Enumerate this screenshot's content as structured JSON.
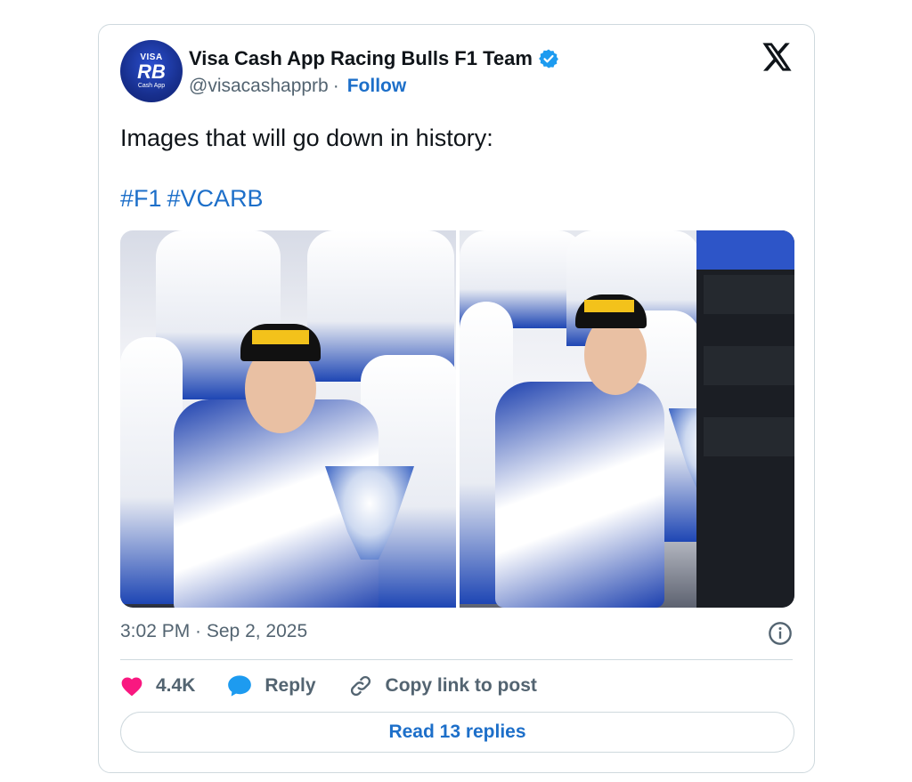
{
  "author": {
    "display_name": "Visa Cash App Racing Bulls F1 Team",
    "handle": "@visacashapprb",
    "separator": "·",
    "follow_label": "Follow",
    "avatar": {
      "top_text": "VISA",
      "mid_text": "RB",
      "bottom_text": "Cash App",
      "bg_color": "#18308f"
    },
    "verified_badge_color": "#1d9bf0"
  },
  "tweet": {
    "text": "Images that will go down in history:",
    "hashtags": [
      "#F1",
      "#VCARB"
    ],
    "timestamp": "3:02 PM · Sep 2, 2025"
  },
  "media": {
    "photos": [
      {
        "name": "driver-celebrating-with-trophy-left",
        "main_color": "#1b3fae"
      },
      {
        "name": "driver-celebrating-with-crew-right",
        "main_color": "#1b3fae"
      }
    ]
  },
  "actions": {
    "likes_count": "4.4K",
    "reply_label": "Reply",
    "copy_link_label": "Copy link to post",
    "read_replies_label": "Read 13 replies"
  },
  "icons": {
    "x_logo": "x-logo-icon",
    "verified": "verified-badge-icon",
    "info": "info-icon",
    "heart": "heart-icon",
    "reply": "reply-bubble-icon",
    "link": "link-icon"
  },
  "colors": {
    "link_blue": "#1d6fc9",
    "heart_pink": "#f91880",
    "reply_blue": "#1d9bf0",
    "muted_text": "#536471",
    "border": "#cfd9de"
  }
}
